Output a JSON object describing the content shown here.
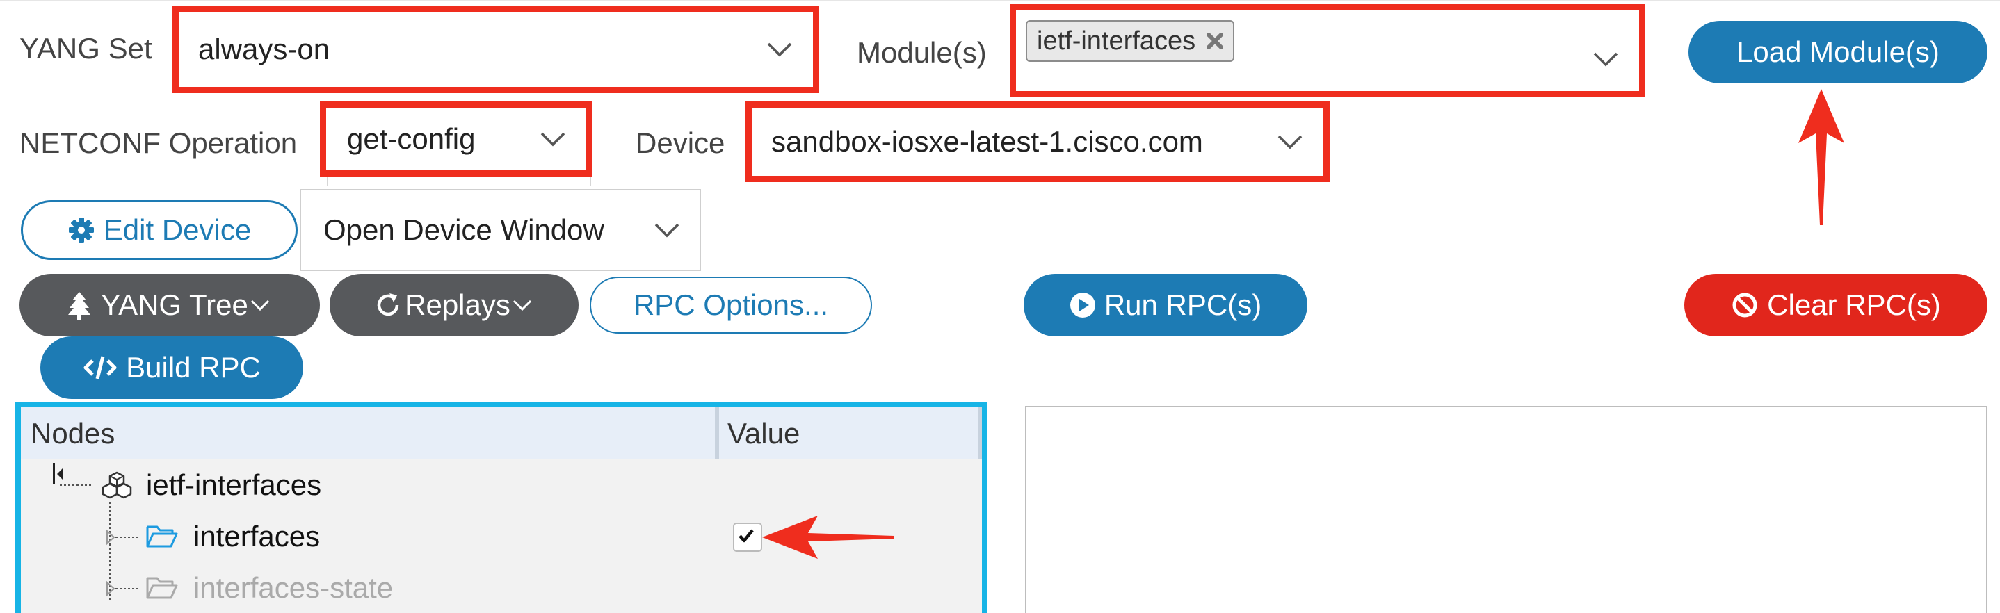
{
  "form": {
    "yang_set_label": "YANG Set",
    "yang_set_value": "always-on",
    "modules_label": "Module(s)",
    "modules_chip": "ietf-interfaces",
    "netconf_label": "NETCONF Operation",
    "netconf_value": "get-config",
    "device_label": "Device",
    "device_value": "sandbox-iosxe-latest-1.cisco.com",
    "open_device_window": "Open Device Window"
  },
  "buttons": {
    "load_modules": "Load Module(s)",
    "edit_device": "Edit Device",
    "yang_tree": "YANG Tree",
    "replays": "Replays",
    "rpc_options": "RPC Options...",
    "run_rpc": "Run RPC(s)",
    "clear_rpc": "Clear RPC(s)",
    "build_rpc": "Build RPC"
  },
  "tree": {
    "col_nodes": "Nodes",
    "col_value": "Value",
    "rows": [
      {
        "label": "ietf-interfaces"
      },
      {
        "label": "interfaces",
        "checked": true
      },
      {
        "label": "interfaces-state"
      }
    ]
  },
  "colors": {
    "accent_blue": "#1d7bb4",
    "annotation_red": "#ef2d1e",
    "tree_border": "#17b4e6",
    "clear_red": "#e1261c"
  },
  "icons": [
    "chevron-down-icon",
    "close-icon",
    "gear-icon",
    "tree-icon",
    "refresh-icon",
    "play-icon",
    "ban-icon",
    "code-icon",
    "cubes-icon",
    "folder-open-icon",
    "check-icon",
    "arrow-icon"
  ]
}
